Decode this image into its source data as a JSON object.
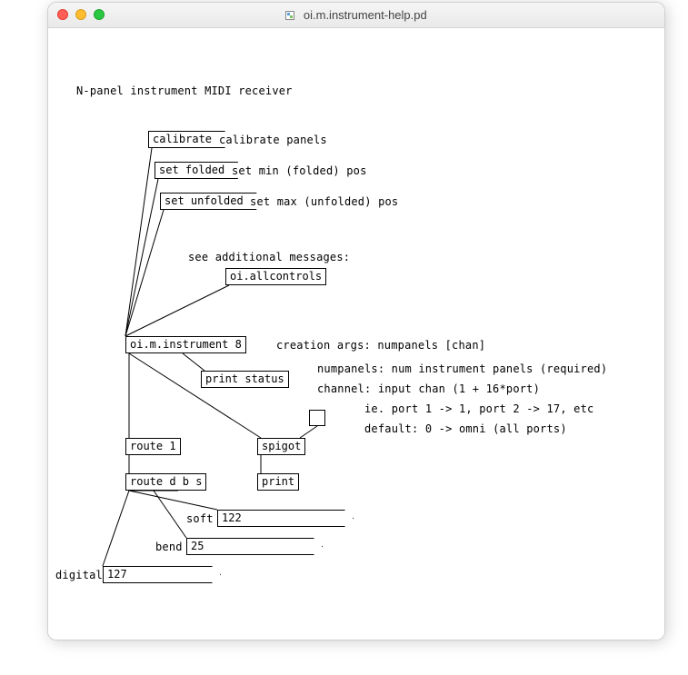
{
  "window": {
    "title": "oi.m.instrument-help.pd"
  },
  "text": {
    "header": "N-panel instrument MIDI receiver",
    "calibrate_desc": "calibrate panels",
    "setfolded_desc": "set min (folded) pos",
    "setunfolded_desc": "set max (unfolded) pos",
    "see_additional": "see additional messages:",
    "creation_args": "creation args: numpanels [chan]",
    "numpanels_desc": "numpanels: num instrument panels (required)",
    "channel_desc": "channel: input chan (1 + 16*port)",
    "ie_desc": "ie. port 1 -> 1, port 2 -> 17, etc",
    "default_desc": "default: 0 -> omni (all ports)",
    "label_soft": "soft",
    "label_bend": "bend",
    "label_digital": "digital"
  },
  "boxes": {
    "calibrate": "calibrate",
    "setfolded": "set folded",
    "setunfolded": "set unfolded",
    "allcontrols": "oi.allcontrols",
    "instrument": "oi.m.instrument 8",
    "printstatus": "print status",
    "route1": "route 1",
    "spigot": "spigot",
    "print": "print",
    "routedbs": "route d b s"
  },
  "nums": {
    "soft": "122",
    "bend": "25",
    "digital": "127"
  }
}
